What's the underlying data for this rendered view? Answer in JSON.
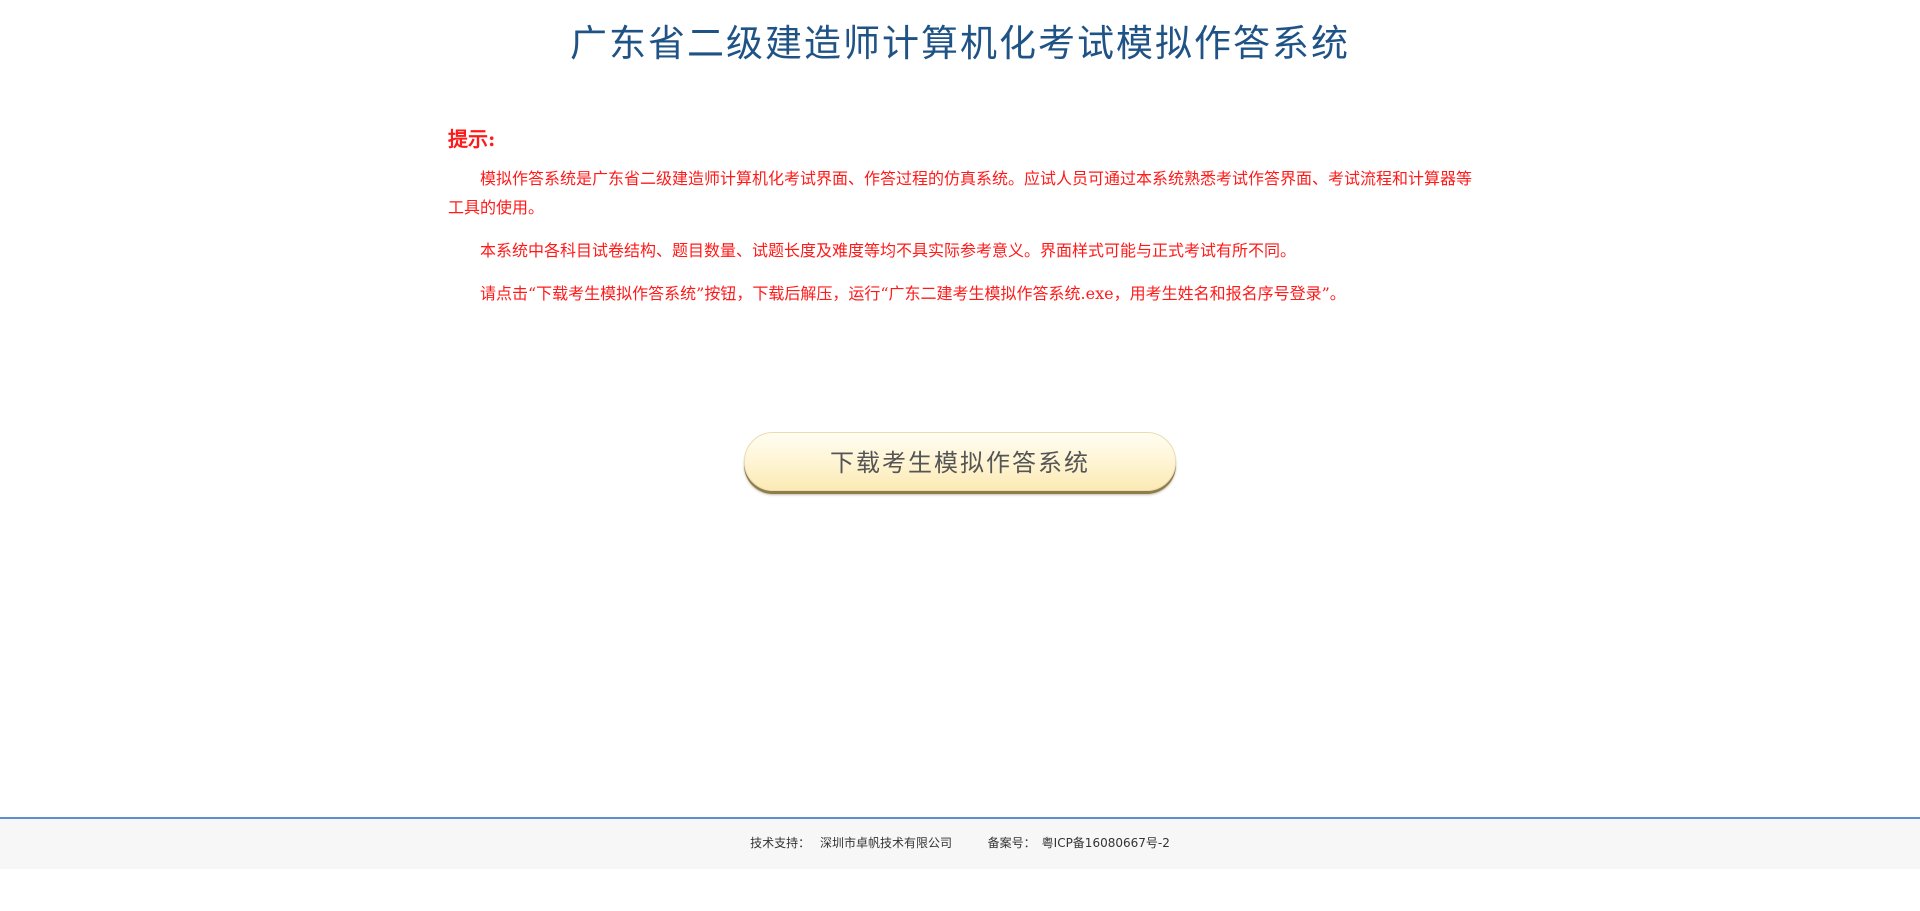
{
  "header": {
    "title": "广东省二级建造师计算机化考试模拟作答系统"
  },
  "tips": {
    "heading": "提示:",
    "paragraphs": [
      "模拟作答系统是广东省二级建造师计算机化考试界面、作答过程的仿真系统。应试人员可通过本系统熟悉考试作答界面、考试流程和计算器等工具的使用。",
      "本系统中各科目试卷结构、题目数量、试题长度及难度等均不具实际参考意义。界面样式可能与正式考试有所不同。",
      "请点击“下载考生模拟作答系统”按钮，下载后解压，运行“广东二建考生模拟作答系统.exe，用考生姓名和报名序号登录”。"
    ]
  },
  "download": {
    "button_label": "下载考生模拟作答系统"
  },
  "footer": {
    "support_label": "技术支持：",
    "support_company": "深圳市卓帆技术有限公司",
    "icp_label": "备案号：",
    "icp_value": "粤ICP备16080667号-2"
  },
  "colors": {
    "title": "#1f5386",
    "tips_text": "#ff1a1a",
    "footer_line": "#5b8fd0"
  }
}
